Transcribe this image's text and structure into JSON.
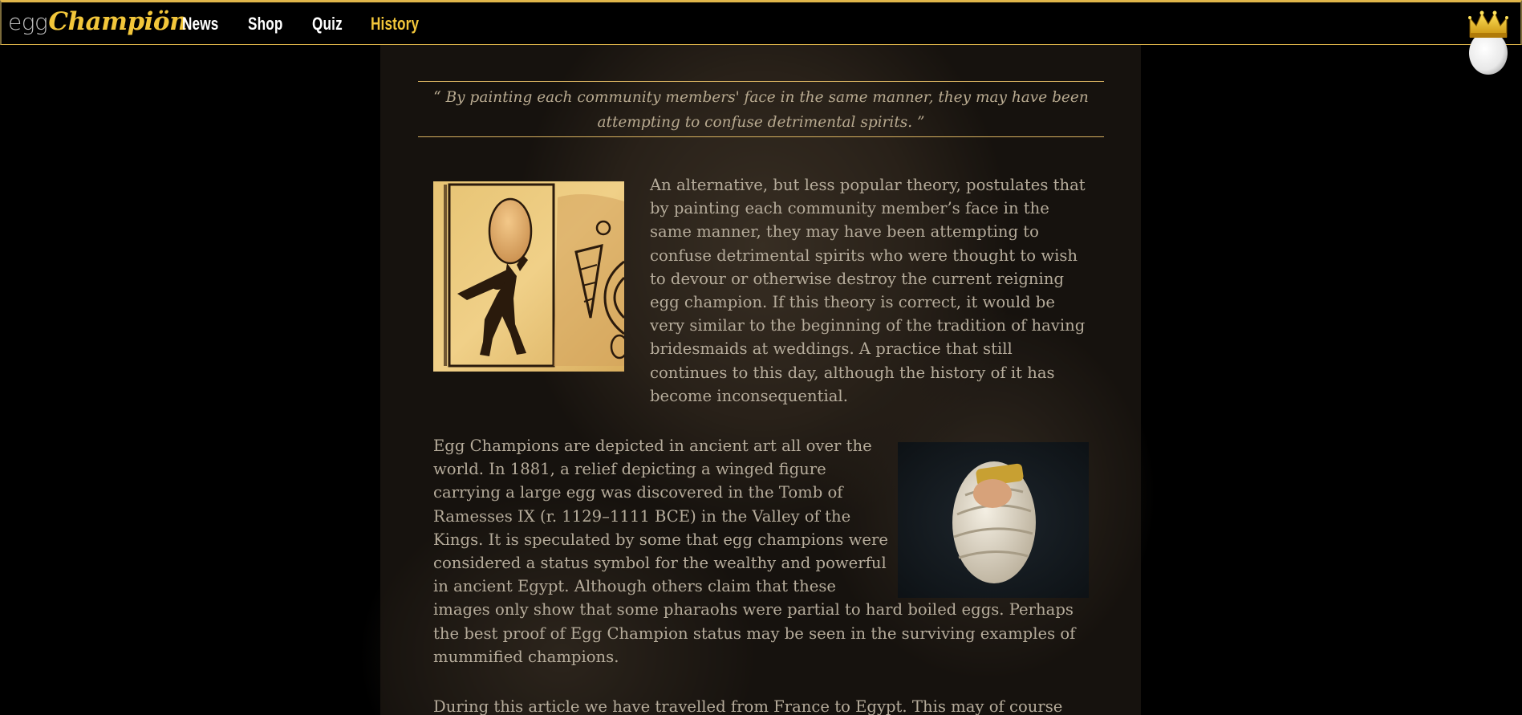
{
  "site": {
    "logo_egg": "egg",
    "logo_champion": "Champiön"
  },
  "nav": {
    "items": [
      {
        "label": "News"
      },
      {
        "label": "Shop"
      },
      {
        "label": "Quiz"
      },
      {
        "label": "History",
        "active": true
      }
    ]
  },
  "colors": {
    "accent": "#f2c63a",
    "rule": "#d7b160",
    "body_text": "#b6ac9b",
    "background": "#000000"
  },
  "article": {
    "pull_quote": "“ By painting each community members' face in the same manner, they may have been attempting to confuse detrimental spirits. ”",
    "paragraph_1": "An alternative, but less popular theory, postulates that by painting each community member’s face in the same manner, they may have been attempting to confuse detrimental spirits who were thought to wish to devour or otherwise destroy the current reigning egg champion. If this theory is correct, it would be very similar to the beginning of the tradition of having bridesmaids at weddings. A practice that still continues to this day, although the history of it has become inconsequential.",
    "paragraph_2": "Egg Champions are depicted in ancient art all over the world. In 1881, a relief depicting a winged figure carrying a large egg was discovered in the Tomb of Ramesses IX (r. 1129–1111 BCE) in the Valley of the Kings. It is speculated by some that egg champions were considered a status symbol for the wealthy and powerful in ancient Egypt. Although others claim that these images only show that some pharaohs were partial to hard boiled eggs. Perhaps the best proof of Egg Champion status may be seen in the surviving examples of mummified champions.",
    "paragraph_3": "During this article we have travelled from France to Egypt. This may of course"
  },
  "icons": {
    "avatar": "crowned-egg-icon",
    "image_1": "hieroglyph-winged-figure-egg",
    "image_2": "mummified-egg"
  }
}
